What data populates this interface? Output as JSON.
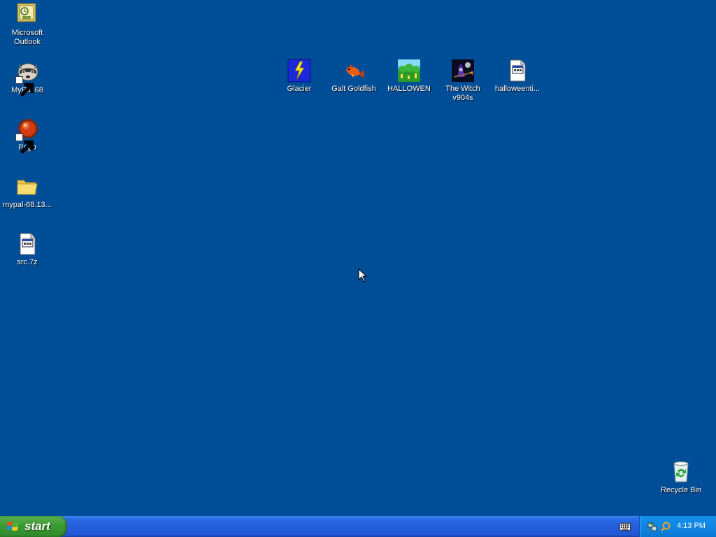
{
  "desktop": {
    "background_color": "#004e98",
    "icons": [
      {
        "label": "Microsoft\nOutlook",
        "icon": "outlook-icon"
      },
      {
        "label": "MyPal 68",
        "icon": "mypal-raccoon-icon"
      },
      {
        "label": "Pego",
        "icon": "pego-ball-icon"
      },
      {
        "label": "mypal-68.13...",
        "icon": "folder-icon"
      },
      {
        "label": "src.7z",
        "icon": "archive-file-icon"
      },
      {
        "label": "Glacier",
        "icon": "glacier-icon"
      },
      {
        "label": "Galt Goldfish",
        "icon": "goldfish-icon"
      },
      {
        "label": "HALLOWEN",
        "icon": "halloween-game-icon"
      },
      {
        "label": "The Witch\nv904s",
        "icon": "witch-icon"
      },
      {
        "label": "halloweenti...",
        "icon": "generic-file-icon"
      },
      {
        "label": "Recycle Bin",
        "icon": "recycle-bin-icon"
      }
    ]
  },
  "taskbar": {
    "start_label": "start",
    "clock": "4:13 PM",
    "colors": {
      "taskbar": "#245ddb",
      "start_button": "#3c9a34",
      "tray": "#0f86e2"
    }
  }
}
